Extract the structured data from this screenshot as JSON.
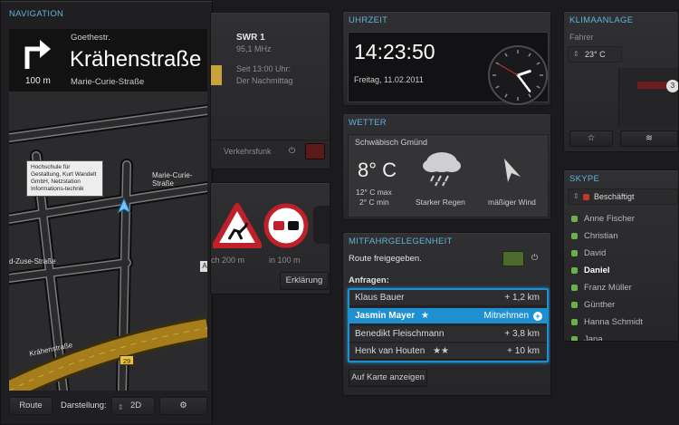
{
  "navigation": {
    "header": "NAVIGATION",
    "turn_distance": "100 m",
    "from_street": "Goethestr.",
    "current_street": "Krähenstraße",
    "next_street": "Marie-Curie-Straße",
    "poi_label": "Hochschule für Gestaltung, Kurt Wandelt GmbH, Netzstation Informations-technik",
    "map_labels": {
      "marie_curie": "Marie-Curie-Straße",
      "zuse": "d-Zuse-Straße",
      "kraehen": "Krähenstraße",
      "route_shield": "29",
      "edge_a": "A"
    },
    "route_button": "Route",
    "darstellung_label": "Darstellung:",
    "mode_value": "2D"
  },
  "radio": {
    "station": "SWR 1",
    "frequency": "95,1 MHz",
    "since": "Seit 13:00 Uhr:",
    "program": "Der Nachmittag",
    "traffic_label": "Verkehrsfunk"
  },
  "signs": {
    "distance_1": "ch 200 m",
    "distance_2": "in 100 m",
    "explain_button": "Erklärung"
  },
  "clock": {
    "header": "UHRZEIT",
    "time": "14:23:50",
    "date": "Freitag, 11.02.2011",
    "hour": 14,
    "minute": 23,
    "second": 50
  },
  "weather": {
    "header": "WETTER",
    "city": "Schwäbisch Gmünd",
    "temp": "8° C",
    "max": "12° C max",
    "min": "2° C min",
    "condition": "Starker Regen",
    "wind": "mäßiger Wind"
  },
  "ride": {
    "header": "MITFAHRGELEGENHEIT",
    "status": "Route freigegeben.",
    "requests_label": "Anfragen:",
    "rows": [
      {
        "name": "Klaus Bauer",
        "stars": "",
        "dist": "+ 1,2 km"
      },
      {
        "name": "Jasmin Mayer",
        "stars": "★",
        "dist": "Mitnehmen"
      },
      {
        "name": "Benedikt Fleischmann",
        "stars": "",
        "dist": "+ 3,8 km"
      },
      {
        "name": "Henk van Houten",
        "stars": "★★",
        "dist": "+ 10 km"
      }
    ],
    "map_button": "Auf Karte anzeigen"
  },
  "climate": {
    "header": "KLIMAANLAGE",
    "driver_label": "Fahrer",
    "temp": "23° C",
    "badge": "3"
  },
  "skype": {
    "header": "SKYPE",
    "status": "Beschäftigt",
    "contacts": [
      "Anne Fischer",
      "Christian",
      "David",
      "Daniel",
      "Franz Müller",
      "Günther",
      "Hanna Schmidt",
      "Jana"
    ]
  },
  "colors": {
    "accent": "#5fb2dc",
    "selection": "#1e8fd0",
    "online": "#6ab04c"
  }
}
